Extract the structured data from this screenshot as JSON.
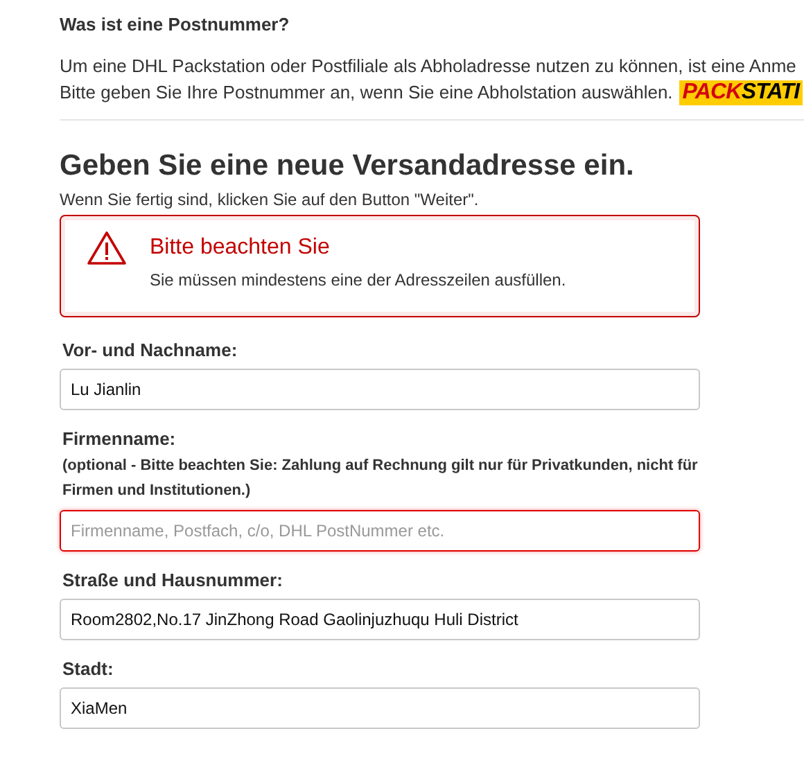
{
  "info": {
    "title": "Was ist eine Postnummer?",
    "lines": [
      "Um eine DHL Packstation oder Postfiliale als Abholadresse nutzen zu können, ist eine Anme",
      "Bitte geben Sie Ihre Postnummer an, wenn Sie eine Abholstation auswählen."
    ],
    "logo": [
      {
        "text": "PACK",
        "kind": "accent"
      },
      {
        "text": "STATI",
        "kind": "plain"
      }
    ]
  },
  "heading": "Geben Sie eine neue Versandadresse ein.",
  "subtitle": "Wenn Sie fertig sind, klicken Sie auf den Button \"Weiter\".",
  "alert": {
    "title": "Bitte beachten Sie",
    "message": "Sie müssen mindestens eine der Adresszeilen ausfüllen."
  },
  "fields": [
    {
      "label": "Vor- und Nachname:",
      "value": "Lu Jianlin",
      "error": false
    },
    {
      "label": "Firmenname:",
      "note": "(optional - Bitte beachten Sie: Zahlung auf Rechnung gilt nur für Privatkunden, nicht für Firmen und Institutionen.)",
      "placeholder": "Firmenname, Postfach, c/o, DHL PostNummer etc.",
      "error": true
    },
    {
      "label": "Straße und Hausnummer:",
      "value": "Room2802,No.17 JinZhong Road Gaolinjuzhuqu Huli District",
      "error": false
    },
    {
      "label": "Stadt:",
      "value": "XiaMen",
      "error": false
    }
  ]
}
